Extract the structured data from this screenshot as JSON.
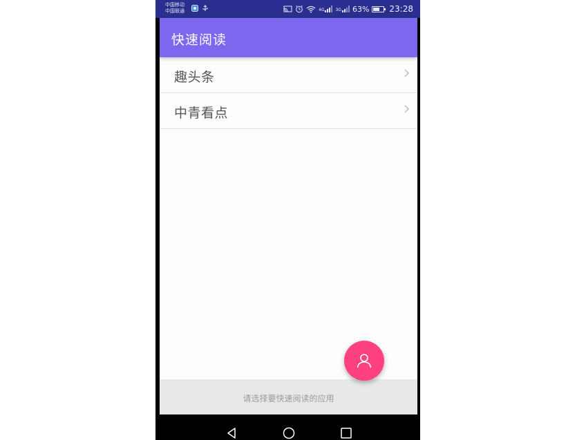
{
  "status_bar": {
    "carrier_1": "中国移动",
    "carrier_2": "中国联通",
    "network_1": "4G",
    "network_2": "3G",
    "battery_percent": "63%",
    "battery_level": 0.63,
    "time": "23:28"
  },
  "app_bar": {
    "title": "快速阅读"
  },
  "list": {
    "items": [
      {
        "label": "趣头条"
      },
      {
        "label": "中青看点"
      }
    ]
  },
  "fab": {
    "icon": "person-icon",
    "color": "#ff4081"
  },
  "bottom_banner": {
    "text": "请选择要快速阅读的应用"
  },
  "nav_bar": {
    "back_icon": "triangle-back-icon",
    "home_icon": "circle-home-icon",
    "recents_icon": "square-recents-icon"
  },
  "colors": {
    "accent": "#7b68ee",
    "status_bar": "#2a2f8f",
    "fab": "#ff4081"
  }
}
